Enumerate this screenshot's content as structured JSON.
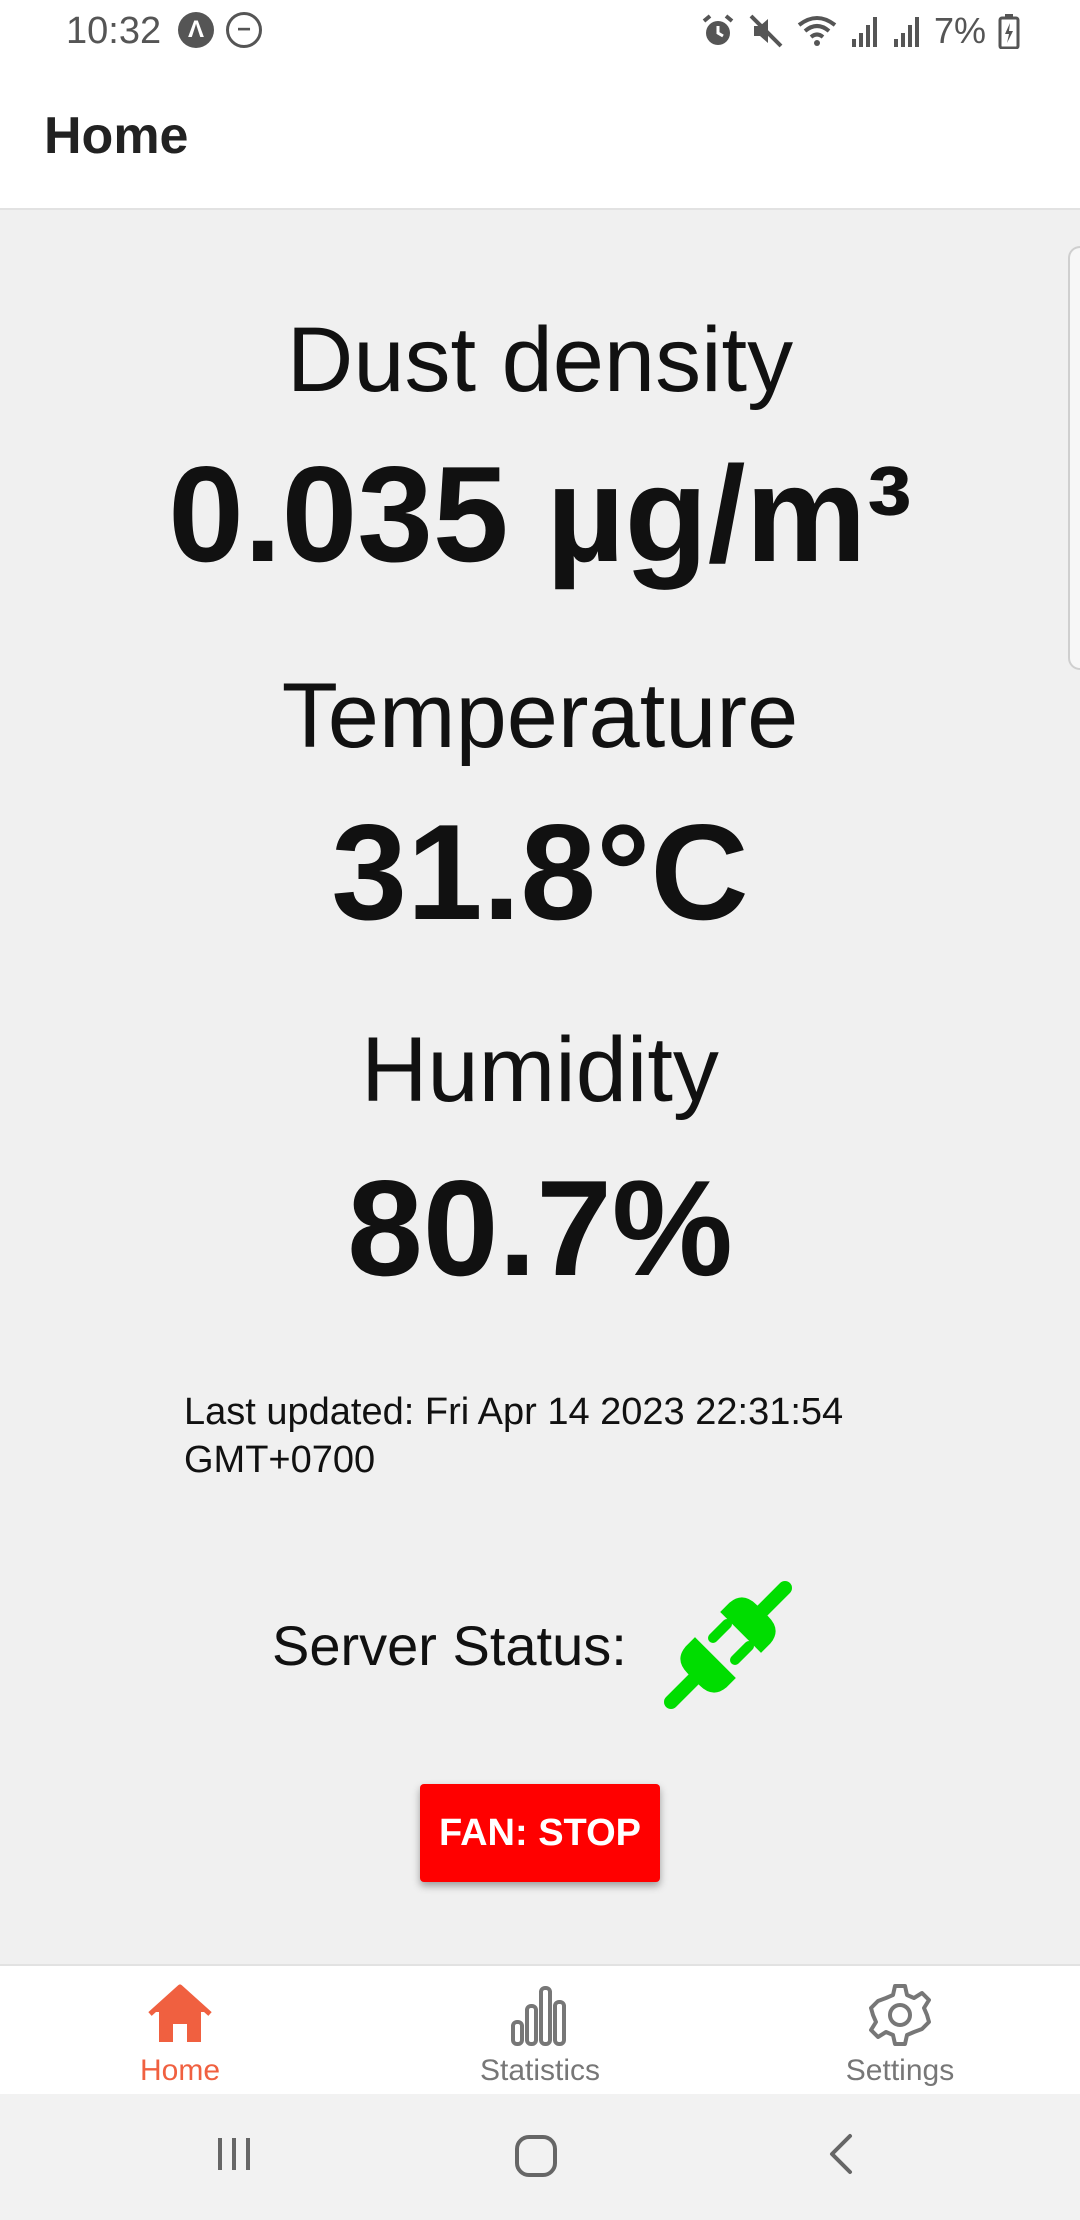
{
  "status_bar": {
    "time": "10:32",
    "battery": "7%"
  },
  "app_bar": {
    "title": "Home"
  },
  "metrics": {
    "dust": {
      "label": "Dust density",
      "value": "0.035 µg/m³"
    },
    "temperature": {
      "label": "Temperature",
      "value": "31.8°C"
    },
    "humidity": {
      "label": "Humidity",
      "value": "80.7%"
    }
  },
  "last_updated": "Last updated: Fri Apr 14 2023 22:31:54 GMT+0700",
  "server_status": {
    "label": "Server Status:",
    "icon": "plug-connected-icon",
    "color": "#00dd00"
  },
  "fan_button": {
    "label": "FAN: STOP",
    "color": "#ff0000"
  },
  "bottom_nav": {
    "active_color": "#f06040",
    "items": [
      {
        "label": "Home",
        "icon": "home-icon"
      },
      {
        "label": "Statistics",
        "icon": "bar-chart-icon"
      },
      {
        "label": "Settings",
        "icon": "gear-icon"
      }
    ]
  }
}
